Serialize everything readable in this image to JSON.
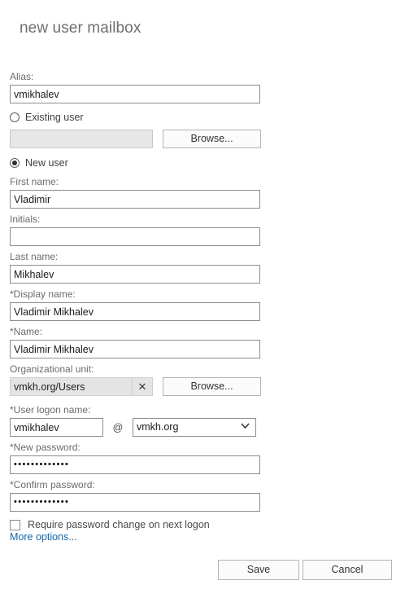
{
  "dialog": {
    "title": "new user mailbox"
  },
  "fields": {
    "alias": {
      "label": "Alias:",
      "value": "vmikhalev",
      "placeholder": ""
    },
    "existing_user": {
      "radio_label": "Existing user",
      "selected": false,
      "value": "",
      "placeholder": "",
      "browse_label": "Browse..."
    },
    "new_user": {
      "radio_label": "New user",
      "selected": true
    },
    "first_name": {
      "label": "First name:",
      "value": "Vladimir",
      "placeholder": ""
    },
    "initials": {
      "label": "Initials:",
      "value": "",
      "placeholder": ""
    },
    "last_name": {
      "label": "Last name:",
      "value": "Mikhalev",
      "placeholder": ""
    },
    "display_name": {
      "label": "*Display name:",
      "value": "Vladimir Mikhalev",
      "placeholder": ""
    },
    "name": {
      "label": "*Name:",
      "value": "Vladimir Mikhalev",
      "placeholder": ""
    },
    "organizational_unit": {
      "label": "Organizational unit:",
      "value": "vmkh.org/Users",
      "clear_icon": "close-icon",
      "browse_label": "Browse..."
    },
    "user_logon_name": {
      "label": "*User logon name:",
      "value": "vmikhalev",
      "placeholder": "",
      "separator": "@",
      "domain_selected": "vmkh.org",
      "domain_options": [
        "vmkh.org"
      ]
    },
    "new_password": {
      "label": "*New password:",
      "value": "•••••••••••••",
      "placeholder": ""
    },
    "confirm_password": {
      "label": "*Confirm password:",
      "value": "•••••••••••••",
      "placeholder": ""
    },
    "require_password_change": {
      "label": "Require password change on next logon",
      "checked": false
    }
  },
  "links": {
    "more_options": "More options..."
  },
  "footer": {
    "save_label": "Save",
    "cancel_label": "Cancel"
  },
  "colors": {
    "link": "#1265a8",
    "title": "#6e6e6e",
    "label": "#6b6b6b",
    "field_border": "#8d8d8d",
    "disabled_bg": "#e4e4e4"
  }
}
